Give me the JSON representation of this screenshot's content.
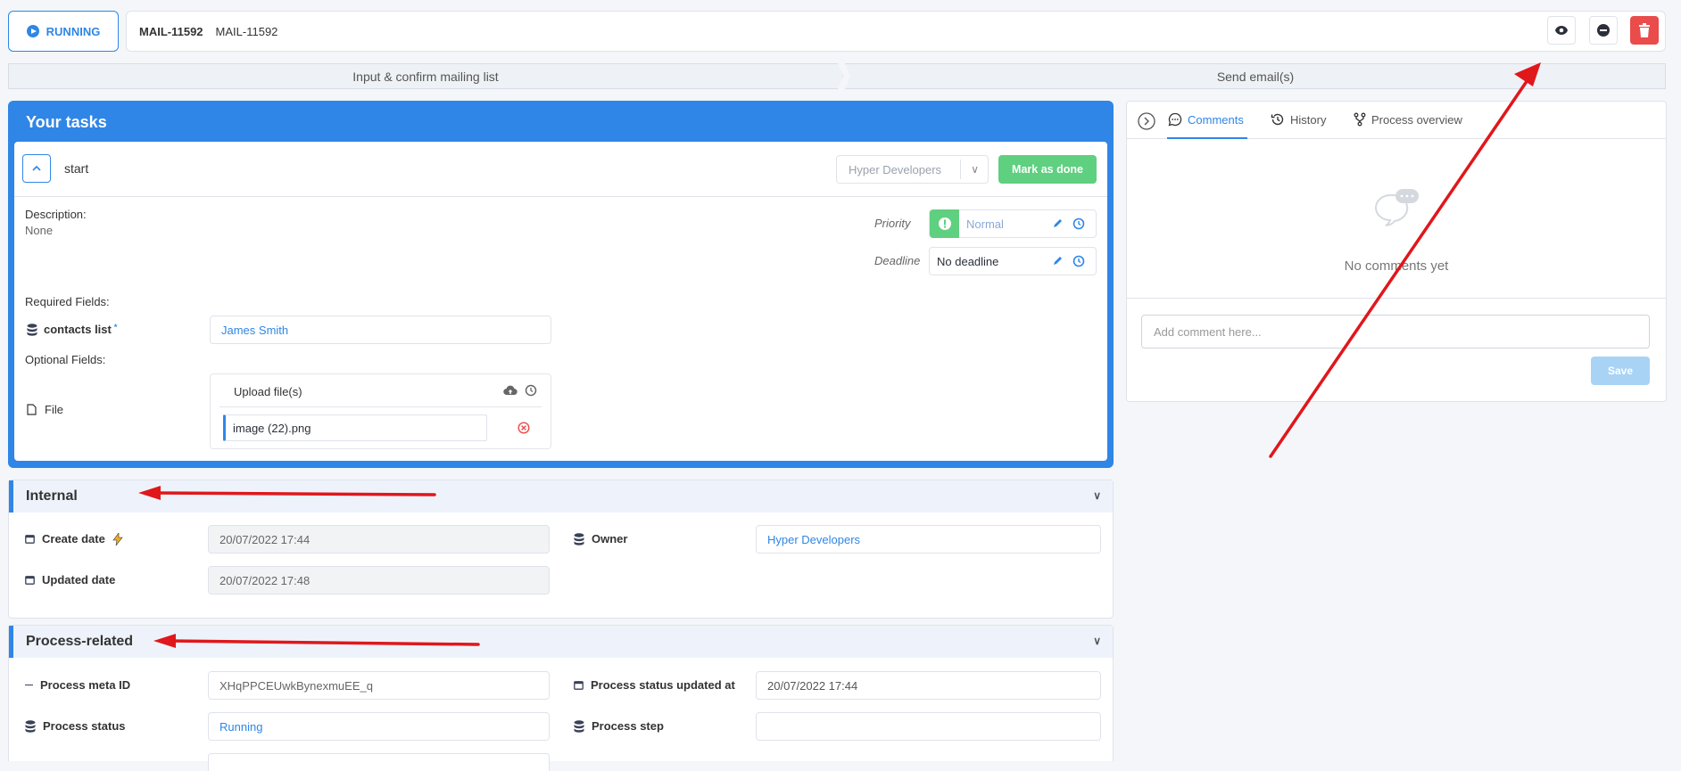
{
  "header": {
    "status_label": "RUNNING",
    "title": "MAIL-11592",
    "subtitle": "MAIL-11592"
  },
  "steps": [
    "Input & confirm mailing list",
    "Send email(s)"
  ],
  "tasks": {
    "title": "Your tasks",
    "task_name": "start",
    "assignee": "Hyper Developers",
    "mark_done_label": "Mark as done",
    "description_label": "Description:",
    "description_value": "None",
    "priority_label": "Priority",
    "priority_value": "Normal",
    "deadline_label": "Deadline",
    "deadline_value": "No deadline",
    "required_label": "Required Fields:",
    "contacts_label": "contacts list",
    "contacts_value": "James Smith",
    "optional_label": "Optional Fields:",
    "file_label": "File",
    "upload_label": "Upload file(s)",
    "file_name": "image (22).png"
  },
  "internal": {
    "title": "Internal",
    "create_date_label": "Create date",
    "create_date_value": "20/07/2022 17:44",
    "updated_date_label": "Updated date",
    "updated_date_value": "20/07/2022 17:48",
    "owner_label": "Owner",
    "owner_value": "Hyper Developers"
  },
  "process": {
    "title": "Process-related",
    "meta_id_label": "Process meta ID",
    "meta_id_value": "XHqPPCEUwkBynexmuEE_q",
    "status_updated_label": "Process status updated at",
    "status_updated_value": "20/07/2022 17:44",
    "status_label": "Process status",
    "status_value": "Running",
    "step_label": "Process step",
    "step_value": ""
  },
  "comments": {
    "tabs": [
      "Comments",
      "History",
      "Process overview"
    ],
    "empty_text": "No comments yet",
    "input_placeholder": "Add comment here...",
    "save_label": "Save"
  },
  "colors": {
    "accent": "#2f86e6",
    "success": "#5fcf80",
    "danger": "#ea4b4b",
    "annotation": "#e0171b"
  }
}
